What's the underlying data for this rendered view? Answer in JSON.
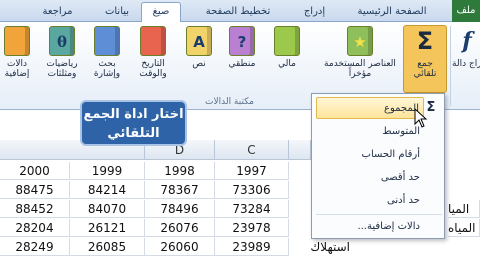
{
  "tabs": [
    {
      "label": "ملف",
      "kind": "file"
    },
    {
      "label": "الصفحة الرئيسية",
      "kind": "normal"
    },
    {
      "label": "إدراج",
      "kind": "normal"
    },
    {
      "label": "تخطيط الصفحة",
      "kind": "normal"
    },
    {
      "label": "صيغ",
      "kind": "active"
    },
    {
      "label": "بيانات",
      "kind": "normal"
    },
    {
      "label": "مراجعة",
      "kind": "normal"
    }
  ],
  "ribbon": {
    "insert_function_label": "إدراج دالة",
    "autosum": {
      "icon": "Σ",
      "label_line1": "جمع",
      "label_line2": "تلقائي"
    },
    "recent_label_line1": "العناصر المستخدمة",
    "recent_label_line2": "مؤخراً",
    "financial_label": "مالي",
    "logical_label": "منطقي",
    "text_label": "نص",
    "datetime_label_line1": "التاريخ",
    "datetime_label_line2": "والوقت",
    "lookup_label_line1": "بحث",
    "lookup_label_line2": "وإشارة",
    "math_label_line1": "رياضيات",
    "math_label_line2": "ومثلثات",
    "more_label_line1": "دالات",
    "more_label_line2": "إضافية",
    "group_label": "مكتبة الدالات"
  },
  "callout": {
    "line1": "اختار اداة الجمع",
    "line2": "التلقائي"
  },
  "menu": {
    "items": [
      {
        "label": "المجموع",
        "icon": "Σ",
        "highlighted": true
      },
      {
        "label": "المتوسط",
        "icon": "",
        "highlighted": false
      },
      {
        "label": "أرقام الحساب",
        "icon": "",
        "highlighted": false
      },
      {
        "label": "حد أقصى",
        "icon": "",
        "highlighted": false
      },
      {
        "label": "حد أدنى",
        "icon": "",
        "highlighted": false
      },
      {
        "label": "دالات إضافية...",
        "icon": "",
        "highlighted": false
      }
    ]
  },
  "sheet": {
    "columns": [
      "D",
      "C"
    ],
    "rows": [
      [
        "2000",
        "1999",
        "1998",
        "1997"
      ],
      [
        "88475",
        "84214",
        "78367",
        "73306"
      ],
      [
        "88452",
        "84070",
        "78496",
        "73284"
      ],
      [
        "28204",
        "26121",
        "26076",
        "23978"
      ],
      [
        "28249",
        "26085",
        "26060",
        "23989"
      ]
    ],
    "row_labels": [
      "الميا",
      "المياه",
      "استهلاك"
    ]
  }
}
